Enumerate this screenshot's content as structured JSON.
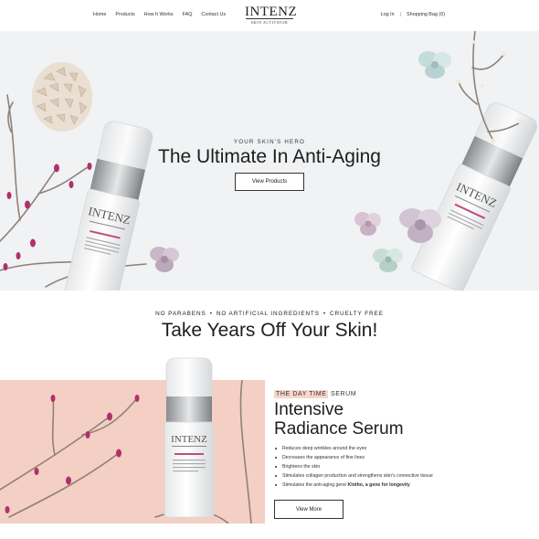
{
  "header": {
    "nav": [
      "Home",
      "Products",
      "How It Works",
      "FAQ",
      "Contact Us"
    ],
    "logo": {
      "main": "INTENZ",
      "sub": "SKIN ACTIVATOR"
    },
    "login": "Log In",
    "separator": "|",
    "bag": "Shopping Bag (0)"
  },
  "hero": {
    "eyebrow": "YOUR SKIN'S HERO",
    "title": "The Ultimate In Anti-Aging",
    "button": "View Products",
    "bottle_brand": "INTENZ"
  },
  "benefits": [
    "NO PARABENS",
    "NO ARTIFICIAL INGREDIENTS",
    "CRUELTY FREE"
  ],
  "headline": "Take Years Off Your Skin!",
  "product": {
    "tag_highlight": "THE DAY TIME",
    "tag_rest": "SERUM",
    "title": "Intensive Radiance Serum",
    "bullets": [
      "Reduces deep wrinkles around the eyes",
      "Decreases the appearance of fine lines",
      "Brightens the skin",
      "Stimulates collagen production and strengthens skin's connective tissue"
    ],
    "last_bullet_prefix": "Stimulates the anti-aging gene ",
    "last_bullet_bold": "Klotho, a gene for longevity",
    "button": "View More",
    "bottle_brand": "INTENZ"
  },
  "colors": {
    "hero_bg": "#f0f2f3",
    "pink_panel": "#f4cfc3",
    "tag_highlight": "#f6d6cb",
    "berry": "#b0306e",
    "flower": "#c9b7c8"
  }
}
